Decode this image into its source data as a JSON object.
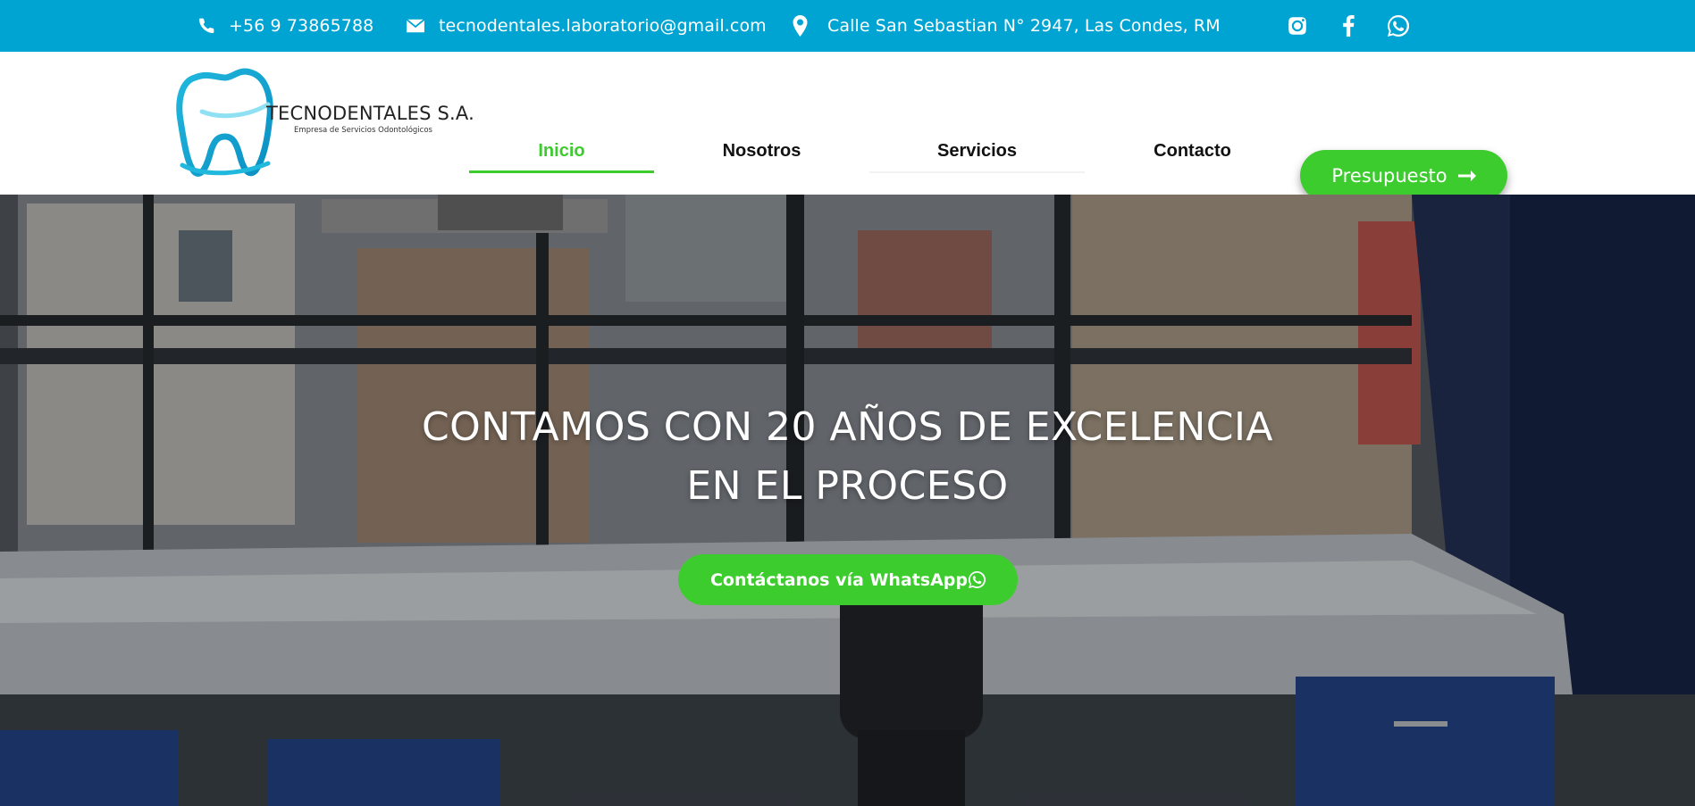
{
  "topbar": {
    "phone": "+56 9 73865788",
    "email": "tecnodentales.laboratorio@gmail.com",
    "address": "Calle San Sebastian N° 2947, Las Condes, RM",
    "icons": [
      "phone-icon",
      "envelope-icon",
      "map-marker-icon",
      "instagram-icon",
      "facebook-icon",
      "whatsapp-icon"
    ]
  },
  "brand": {
    "name": "TECNODENTALES S.A.",
    "tagline": "Empresa de Servicios Odontológicos"
  },
  "nav": {
    "items": [
      {
        "label": "Inicio",
        "active": true
      },
      {
        "label": "Nosotros",
        "active": false
      },
      {
        "label": "Servicios",
        "active": false
      },
      {
        "label": "Contacto",
        "active": false
      }
    ],
    "cta_label": "Presupuesto"
  },
  "hero": {
    "title_line1": "CONTAMOS CON 20 AÑOS DE EXCELENCIA",
    "title_line2": "EN EL PROCESO",
    "button_label": "Contáctanos vía WhatsApp"
  },
  "colors": {
    "topbar": "#00a4d3",
    "accent_green": "#3ccc2e",
    "nav_text": "#111111",
    "logo_blue": "#1fb3d9"
  }
}
